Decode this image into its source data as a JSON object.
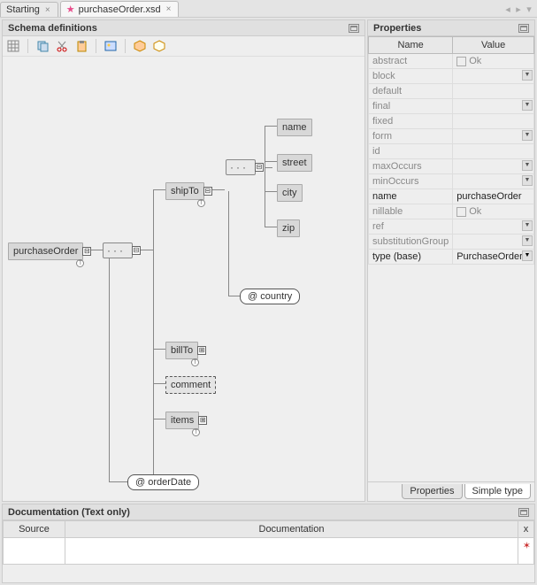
{
  "tabs": {
    "starting": "Starting",
    "file": "purchaseOrder.xsd"
  },
  "schema": {
    "title": "Schema definitions",
    "toolbar_icons": [
      "grid",
      "copy",
      "cut",
      "paste",
      "undo",
      "image",
      "cube1",
      "cube2"
    ],
    "diagram": {
      "root": "purchaseOrder",
      "attr_orderDate": "@ orderDate",
      "shipTo": "shipTo",
      "billTo": "billTo",
      "comment": "comment",
      "items": "items",
      "attr_country": "@ country",
      "name": "name",
      "street": "street",
      "city": "city",
      "zip": "zip"
    }
  },
  "properties": {
    "title": "Properties",
    "headers": {
      "name": "Name",
      "value": "Value"
    },
    "rows": [
      {
        "name": "abstract",
        "value": "Ok",
        "checkbox": true
      },
      {
        "name": "block",
        "value": "",
        "dd": true
      },
      {
        "name": "default",
        "value": ""
      },
      {
        "name": "final",
        "value": "",
        "dd": true
      },
      {
        "name": "fixed",
        "value": ""
      },
      {
        "name": "form",
        "value": "",
        "dd": true
      },
      {
        "name": "id",
        "value": ""
      },
      {
        "name": "maxOccurs",
        "value": "",
        "dd": true
      },
      {
        "name": "minOccurs",
        "value": "",
        "dd": true
      },
      {
        "name": "name",
        "value": "purchaseOrder",
        "active": true
      },
      {
        "name": "nillable",
        "value": "Ok",
        "checkbox": true
      },
      {
        "name": "ref",
        "value": "",
        "dd": true
      },
      {
        "name": "substitutionGroup",
        "value": "",
        "dd": true
      },
      {
        "name": "type (base)",
        "value": "PurchaseOrderT",
        "active": true,
        "dd": true,
        "dark_dd": true
      }
    ],
    "bottom_tabs": {
      "properties": "Properties",
      "simpletype": "Simple type"
    }
  },
  "documentation": {
    "title": "Documentation (Text only)",
    "headers": {
      "source": "Source",
      "doc": "Documentation",
      "x": "x"
    }
  }
}
